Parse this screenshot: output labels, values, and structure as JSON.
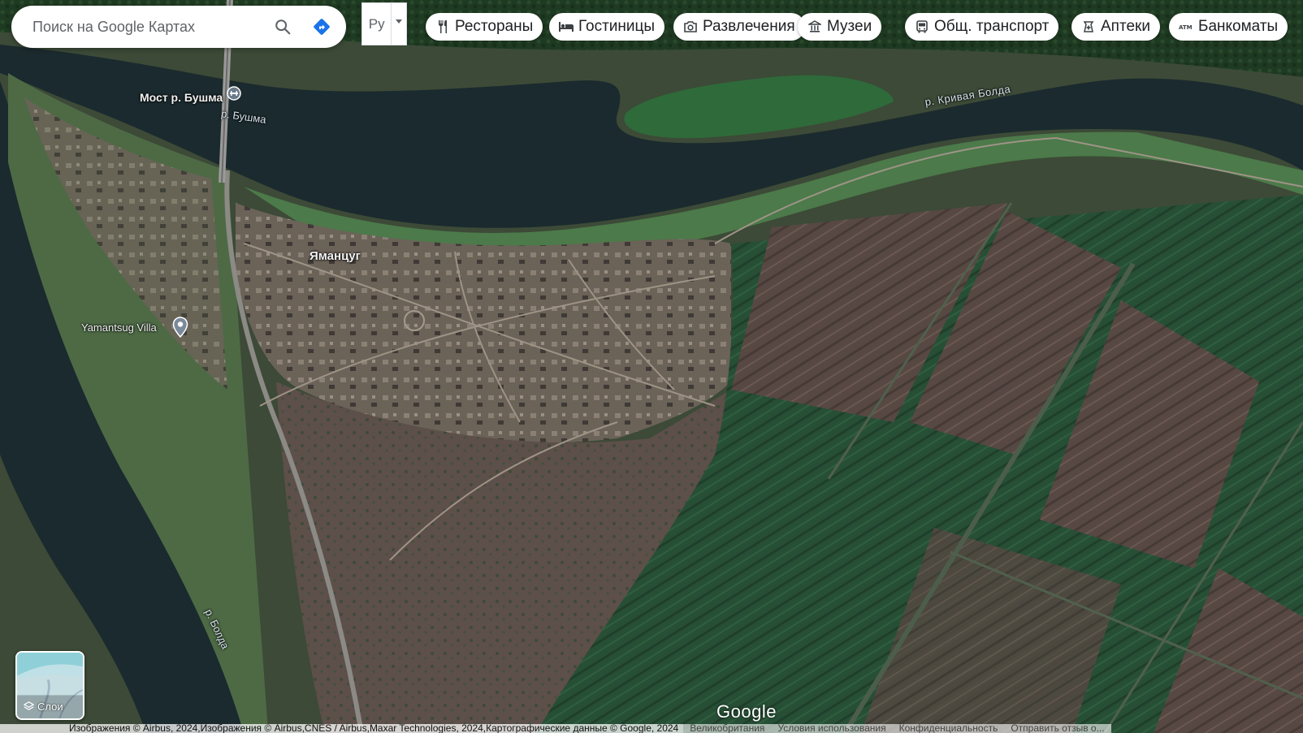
{
  "search": {
    "placeholder": "Поиск на Google Картах"
  },
  "language": {
    "label": "Ру"
  },
  "chips": [
    {
      "label": "Рестораны",
      "icon": "fork-knife-icon"
    },
    {
      "label": "Гостиницы",
      "icon": "bed-icon"
    },
    {
      "label": "Развлечения",
      "icon": "camera-icon"
    },
    {
      "label": "Музеи",
      "icon": "museum-icon"
    },
    {
      "label": "Общ. транспорт",
      "icon": "bus-icon"
    },
    {
      "label": "Аптеки",
      "icon": "pharmacy-icon"
    },
    {
      "label": "Банкоматы",
      "icon": "atm-icon"
    }
  ],
  "map": {
    "type": "satellite",
    "labels": {
      "bridge": "Мост р. Бушма",
      "river_bushma": "р. Бушма",
      "river_krivaya_bolda": "р. Кривая Болда",
      "village": "Яманцуг",
      "villa": "Yamantsug Villa",
      "river_bolda": "р. Болда"
    }
  },
  "layers": {
    "label": "Слои"
  },
  "logo": "Google",
  "attribution": {
    "text": "Изображения © Airbus, 2024,Изображения © Airbus,CNES / Airbus,Maxar Technologies, 2024,Картографические данные © Google, 2024",
    "links": [
      "Великобритания",
      "Условия использования",
      "Конфиденциальность",
      "Отправить отзыв о..."
    ]
  },
  "colors": {
    "water": "#1c2a2f",
    "field_green": "#2d5a3a",
    "field_brown": "#5a4a44",
    "directions_blue": "#1a73e8"
  }
}
